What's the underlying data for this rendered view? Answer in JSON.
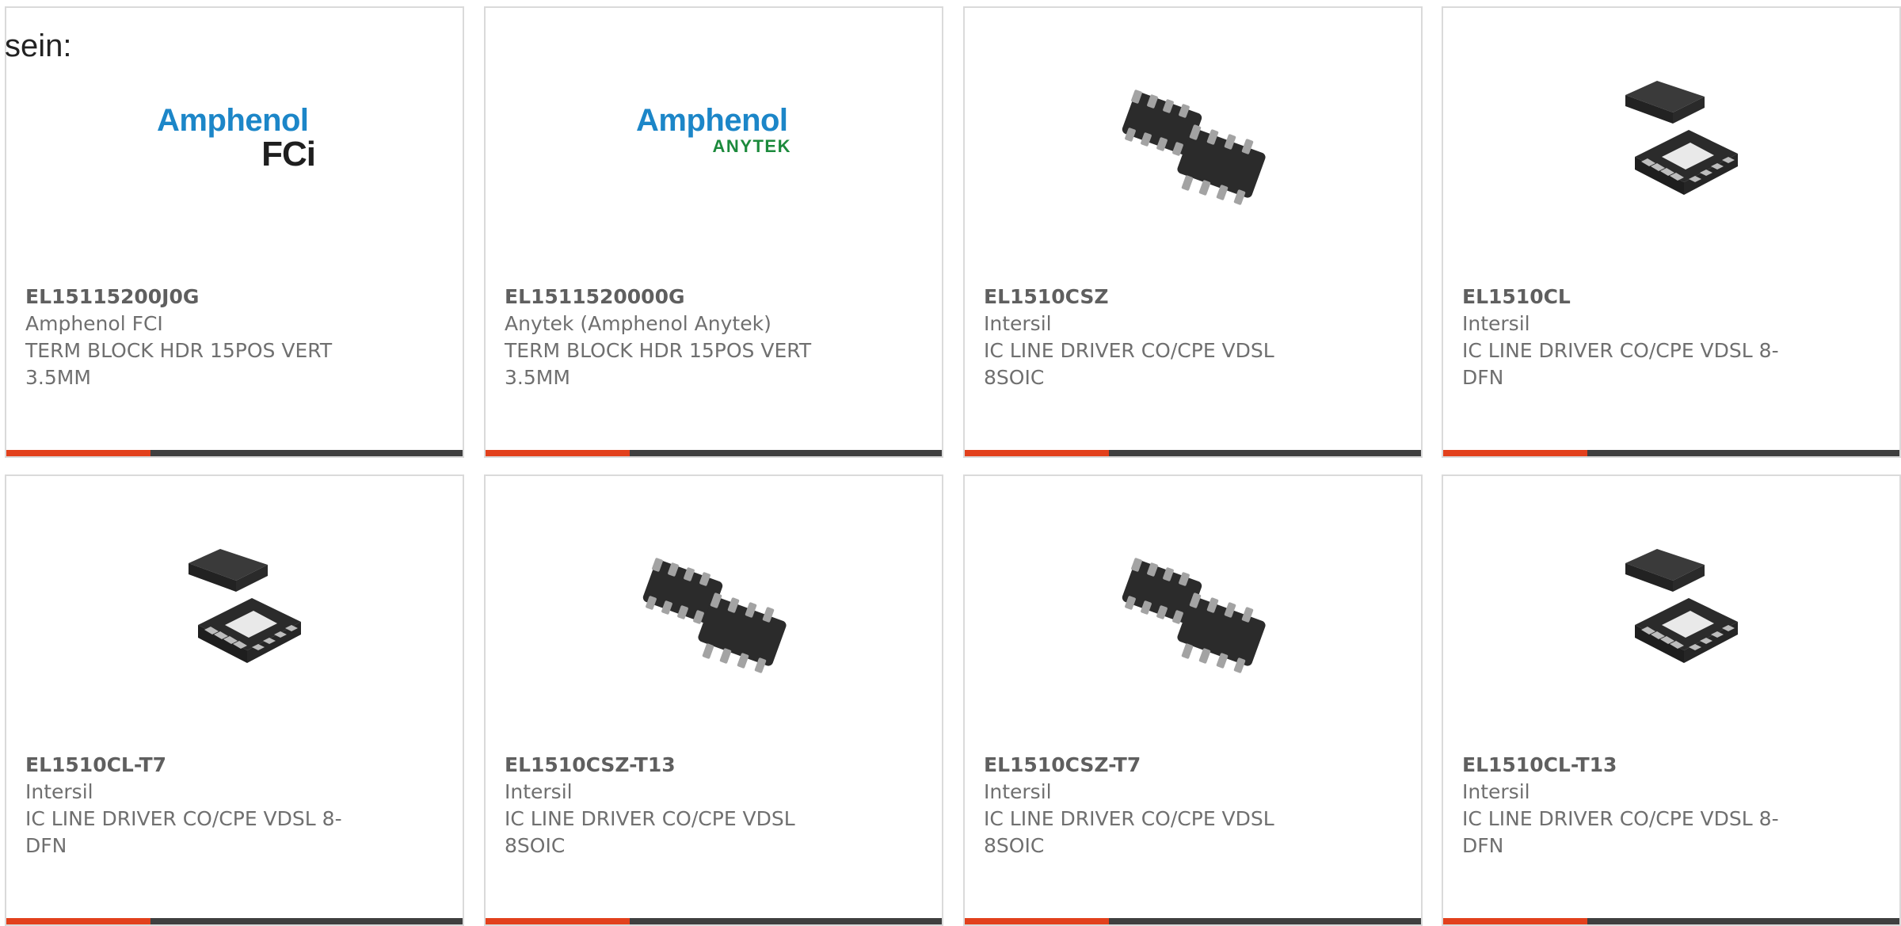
{
  "intro_text": "sein:",
  "products": [
    {
      "part_number": "EL15115200J0G",
      "manufacturer": "Amphenol FCI",
      "description": "TERM BLOCK HDR 15POS VERT 3.5MM",
      "image": "amphenol-fci-logo",
      "logo": {
        "main": "Amphenol",
        "sub": "FCi",
        "sub_color": "#1f1f1f"
      }
    },
    {
      "part_number": "EL1511520000G",
      "manufacturer": "Anytek (Amphenol Anytek)",
      "description": "TERM BLOCK HDR 15POS VERT 3.5MM",
      "image": "amphenol-anytek-logo",
      "logo": {
        "main": "Amphenol",
        "sub": "ANYTEK",
        "sub_color": "#1c8a3c"
      }
    },
    {
      "part_number": "EL1510CSZ",
      "manufacturer": "Intersil",
      "description": "IC LINE DRIVER CO/CPE VDSL 8SOIC",
      "image": "soic-8-chip-icon"
    },
    {
      "part_number": "EL1510CL",
      "manufacturer": "Intersil",
      "description": "IC LINE DRIVER CO/CPE VDSL 8-DFN",
      "image": "dfn-8-chip-icon"
    },
    {
      "part_number": "EL1510CL-T7",
      "manufacturer": "Intersil",
      "description": "IC LINE DRIVER CO/CPE VDSL 8-DFN",
      "image": "dfn-8-chip-icon"
    },
    {
      "part_number": "EL1510CSZ-T13",
      "manufacturer": "Intersil",
      "description": "IC LINE DRIVER CO/CPE VDSL 8SOIC",
      "image": "soic-8-chip-icon"
    },
    {
      "part_number": "EL1510CSZ-T7",
      "manufacturer": "Intersil",
      "description": "IC LINE DRIVER CO/CPE VDSL 8SOIC",
      "image": "soic-8-chip-icon"
    },
    {
      "part_number": "EL1510CL-T13",
      "manufacturer": "Intersil",
      "description": "IC LINE DRIVER CO/CPE VDSL 8-DFN",
      "image": "dfn-8-chip-icon"
    }
  ],
  "colors": {
    "accent_bar": "#e2401c",
    "dark_bar": "#3f3f3f",
    "border": "#dadada",
    "text": "#6f6f6f"
  }
}
